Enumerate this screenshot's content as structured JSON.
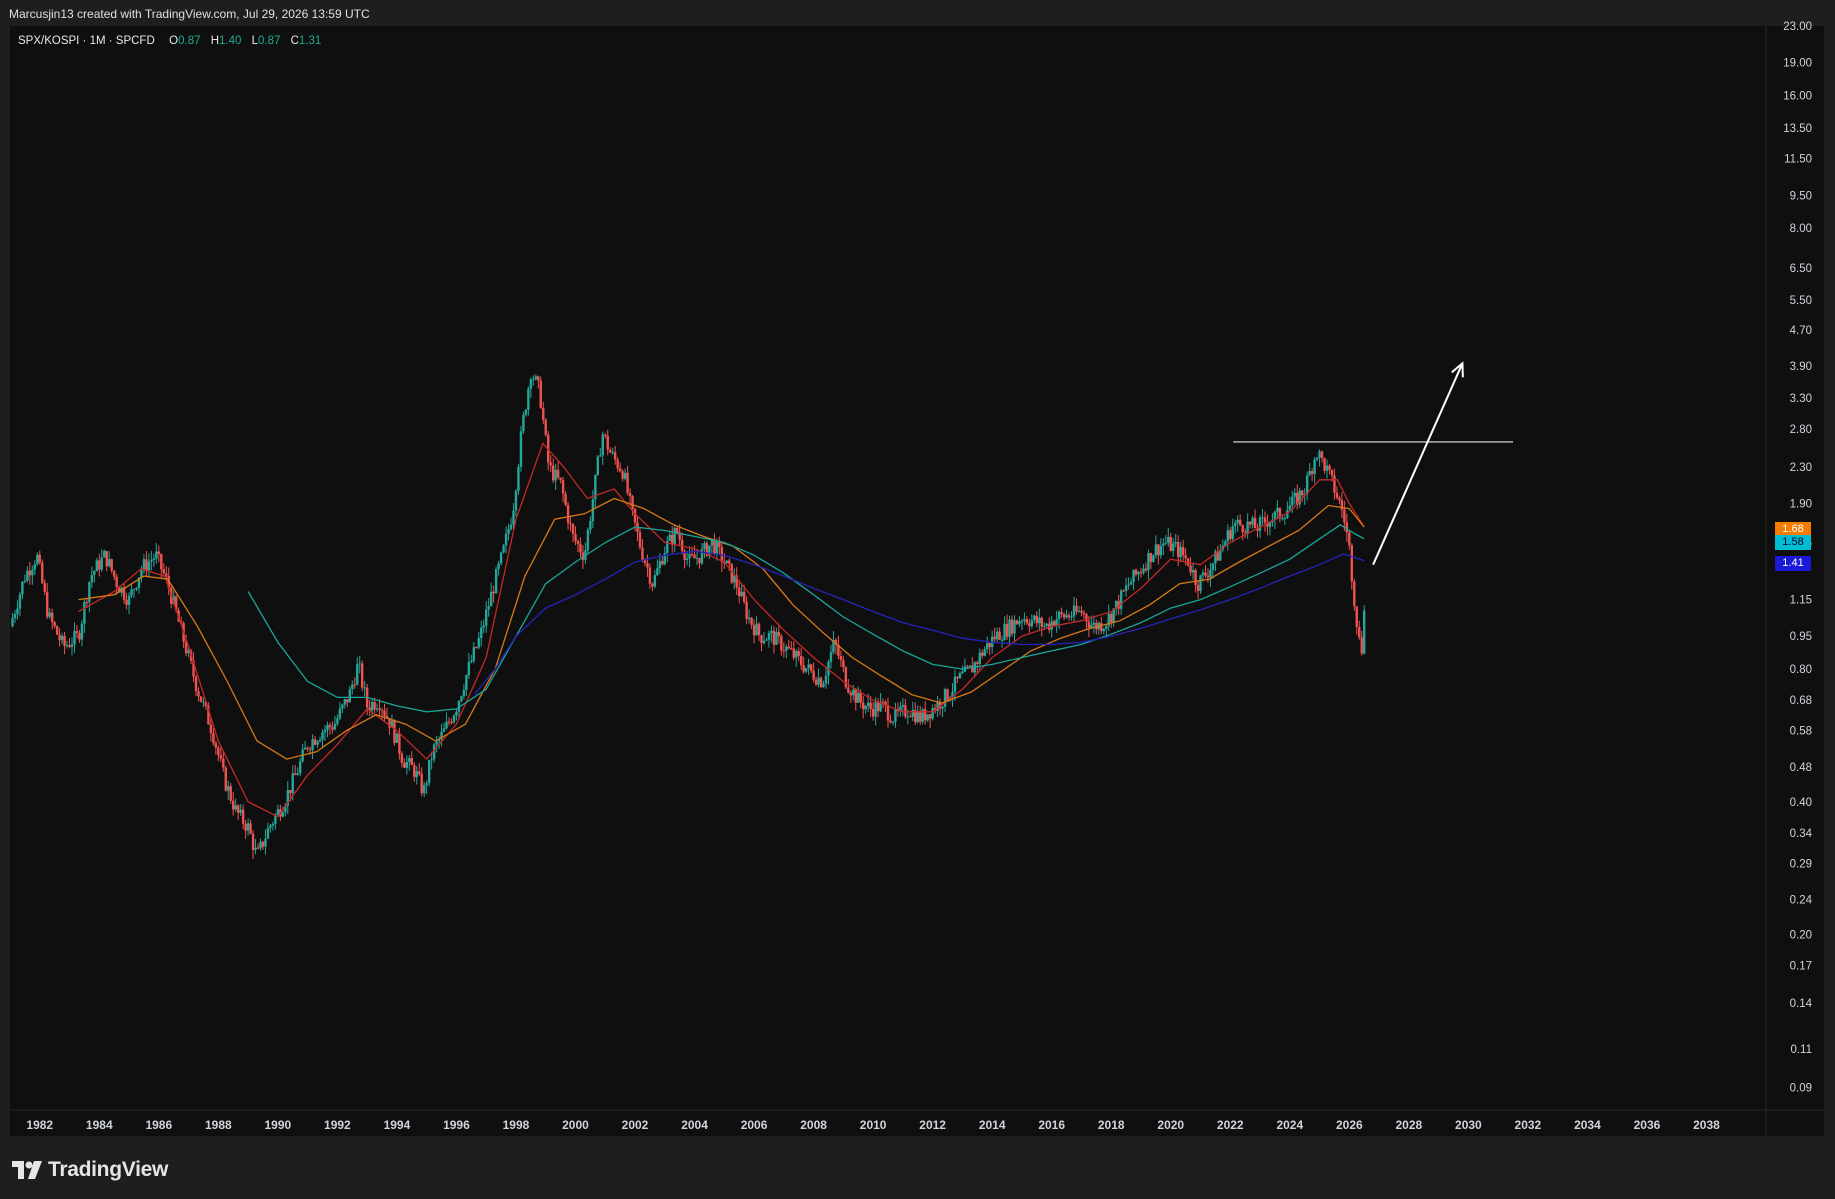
{
  "header": {
    "attribution": "Marcusjin13 created with TradingView.com, Jul 29, 2026 13:59 UTC"
  },
  "legend": {
    "symbol": "SPX/KOSPI · 1M · SPCFD",
    "o_label": "O",
    "o_value": "0.87",
    "h_label": "H",
    "h_value": "1.40",
    "l_label": "L",
    "l_value": "0.87",
    "c_label": "C",
    "c_value": "1.31"
  },
  "footer": {
    "logo": "TradingView"
  },
  "price_tags": [
    {
      "value": "1.68",
      "color": "#f57c00"
    },
    {
      "value": "1.58",
      "color": "#00bcd4"
    },
    {
      "value": "1.41",
      "color": "#1a1ad6"
    }
  ],
  "colors": {
    "background": "#0f0f0f",
    "up": "#26a69a",
    "down": "#ef5350",
    "ma_red": "#c62828",
    "ma_orange": "#d87a16",
    "ma_teal": "#1aa59a",
    "ma_blue": "#2424b8"
  },
  "chart_data": {
    "type": "candlestick",
    "title": "SPX/KOSPI · 1M · SPCFD",
    "scale": "log",
    "ylim": [
      0.08,
      23.0
    ],
    "xlim": [
      1981.0,
      2040.0
    ],
    "y_ticks": [
      "23.00",
      "19.00",
      "16.00",
      "13.50",
      "11.50",
      "9.50",
      "8.00",
      "6.50",
      "5.50",
      "4.70",
      "3.90",
      "3.30",
      "2.80",
      "2.30",
      "1.90",
      "1.55",
      "1.15",
      "0.95",
      "0.80",
      "0.68",
      "0.58",
      "0.48",
      "0.40",
      "0.34",
      "0.29",
      "0.24",
      "0.20",
      "0.17",
      "0.14",
      "0.11",
      "0.09"
    ],
    "x_ticks": [
      "1982",
      "1984",
      "1986",
      "1988",
      "1990",
      "1992",
      "1994",
      "1996",
      "1998",
      "2000",
      "2002",
      "2004",
      "2006",
      "2008",
      "2010",
      "2012",
      "2014",
      "2016",
      "2018",
      "2020",
      "2022",
      "2024",
      "2026",
      "2028",
      "2030",
      "2032",
      "2034",
      "2036",
      "2038"
    ],
    "close_path": [
      [
        1981.0,
        1.0
      ],
      [
        1981.5,
        1.3
      ],
      [
        1981.9,
        1.45
      ],
      [
        1982.3,
        1.05
      ],
      [
        1982.8,
        0.9
      ],
      [
        1983.3,
        0.95
      ],
      [
        1983.7,
        1.3
      ],
      [
        1984.2,
        1.45
      ],
      [
        1984.6,
        1.25
      ],
      [
        1985.0,
        1.15
      ],
      [
        1985.4,
        1.35
      ],
      [
        1985.9,
        1.45
      ],
      [
        1986.3,
        1.25
      ],
      [
        1986.8,
        0.95
      ],
      [
        1987.3,
        0.72
      ],
      [
        1987.8,
        0.58
      ],
      [
        1988.2,
        0.45
      ],
      [
        1988.6,
        0.38
      ],
      [
        1989.0,
        0.35
      ],
      [
        1989.3,
        0.3
      ],
      [
        1989.7,
        0.35
      ],
      [
        1990.2,
        0.4
      ],
      [
        1990.6,
        0.46
      ],
      [
        1991.0,
        0.54
      ],
      [
        1991.5,
        0.58
      ],
      [
        1991.9,
        0.6
      ],
      [
        1992.4,
        0.7
      ],
      [
        1992.7,
        0.82
      ],
      [
        1993.0,
        0.66
      ],
      [
        1993.4,
        0.68
      ],
      [
        1993.8,
        0.6
      ],
      [
        1994.2,
        0.5
      ],
      [
        1994.6,
        0.47
      ],
      [
        1994.9,
        0.42
      ],
      [
        1995.2,
        0.52
      ],
      [
        1995.6,
        0.58
      ],
      [
        1996.0,
        0.66
      ],
      [
        1996.4,
        0.8
      ],
      [
        1996.8,
        0.95
      ],
      [
        1997.2,
        1.2
      ],
      [
        1997.6,
        1.5
      ],
      [
        1997.9,
        1.85
      ],
      [
        1998.2,
        2.8
      ],
      [
        1998.5,
        3.8
      ],
      [
        1998.8,
        3.4
      ],
      [
        1999.1,
        2.3
      ],
      [
        1999.5,
        2.1
      ],
      [
        1999.9,
        1.6
      ],
      [
        2000.3,
        1.45
      ],
      [
        2000.7,
        2.2
      ],
      [
        2000.9,
        2.75
      ],
      [
        2001.2,
        2.45
      ],
      [
        2001.6,
        2.25
      ],
      [
        2001.9,
        1.8
      ],
      [
        2002.2,
        1.5
      ],
      [
        2002.6,
        1.25
      ],
      [
        2003.0,
        1.5
      ],
      [
        2003.4,
        1.65
      ],
      [
        2003.8,
        1.4
      ],
      [
        2004.2,
        1.45
      ],
      [
        2004.6,
        1.55
      ],
      [
        2005.0,
        1.4
      ],
      [
        2005.4,
        1.25
      ],
      [
        2005.8,
        1.05
      ],
      [
        2006.2,
        0.95
      ],
      [
        2006.6,
        0.95
      ],
      [
        2007.0,
        0.9
      ],
      [
        2007.4,
        0.85
      ],
      [
        2007.8,
        0.8
      ],
      [
        2008.3,
        0.75
      ],
      [
        2008.7,
        0.92
      ],
      [
        2009.1,
        0.75
      ],
      [
        2009.5,
        0.68
      ],
      [
        2009.9,
        0.65
      ],
      [
        2010.3,
        0.66
      ],
      [
        2010.7,
        0.62
      ],
      [
        2011.2,
        0.65
      ],
      [
        2011.6,
        0.62
      ],
      [
        2012.1,
        0.66
      ],
      [
        2012.5,
        0.7
      ],
      [
        2012.9,
        0.76
      ],
      [
        2013.3,
        0.8
      ],
      [
        2013.7,
        0.88
      ],
      [
        2014.1,
        0.95
      ],
      [
        2014.6,
        1.0
      ],
      [
        2015.0,
        1.05
      ],
      [
        2015.4,
        1.03
      ],
      [
        2015.8,
        1.0
      ],
      [
        2016.2,
        1.05
      ],
      [
        2016.6,
        1.06
      ],
      [
        2017.0,
        1.08
      ],
      [
        2017.4,
        1.0
      ],
      [
        2017.8,
        1.02
      ],
      [
        2018.2,
        1.12
      ],
      [
        2018.6,
        1.25
      ],
      [
        2019.0,
        1.35
      ],
      [
        2019.4,
        1.48
      ],
      [
        2019.8,
        1.55
      ],
      [
        2020.2,
        1.5
      ],
      [
        2020.6,
        1.4
      ],
      [
        2020.9,
        1.25
      ],
      [
        2021.3,
        1.35
      ],
      [
        2021.7,
        1.5
      ],
      [
        2022.1,
        1.7
      ],
      [
        2022.5,
        1.7
      ],
      [
        2022.9,
        1.68
      ],
      [
        2023.3,
        1.75
      ],
      [
        2023.7,
        1.8
      ],
      [
        2024.1,
        1.9
      ],
      [
        2024.5,
        2.05
      ],
      [
        2024.9,
        2.5
      ],
      [
        2025.2,
        2.3
      ],
      [
        2025.5,
        2.05
      ],
      [
        2025.8,
        1.8
      ],
      [
        2026.0,
        1.5
      ],
      [
        2026.2,
        1.1
      ],
      [
        2026.4,
        0.85
      ],
      [
        2026.55,
        1.31
      ]
    ],
    "moving_averages": [
      {
        "color_key": "ma_red",
        "value": "1.68",
        "points": [
          [
            1983.3,
            1.08
          ],
          [
            1984.5,
            1.2
          ],
          [
            1985.4,
            1.35
          ],
          [
            1986.2,
            1.3
          ],
          [
            1987.0,
            0.9
          ],
          [
            1988.0,
            0.55
          ],
          [
            1989.0,
            0.4
          ],
          [
            1990.0,
            0.37
          ],
          [
            1991.0,
            0.46
          ],
          [
            1992.0,
            0.54
          ],
          [
            1993.0,
            0.65
          ],
          [
            1994.0,
            0.58
          ],
          [
            1995.0,
            0.5
          ],
          [
            1996.0,
            0.6
          ],
          [
            1997.0,
            0.85
          ],
          [
            1998.0,
            1.75
          ],
          [
            1998.9,
            2.6
          ],
          [
            1999.6,
            2.3
          ],
          [
            2000.4,
            1.95
          ],
          [
            2001.3,
            2.05
          ],
          [
            2002.0,
            1.8
          ],
          [
            2003.0,
            1.55
          ],
          [
            2004.0,
            1.5
          ],
          [
            2005.0,
            1.4
          ],
          [
            2006.0,
            1.15
          ],
          [
            2007.0,
            0.98
          ],
          [
            2008.0,
            0.85
          ],
          [
            2009.0,
            0.75
          ],
          [
            2010.0,
            0.68
          ],
          [
            2011.0,
            0.64
          ],
          [
            2012.0,
            0.64
          ],
          [
            2013.0,
            0.72
          ],
          [
            2014.0,
            0.85
          ],
          [
            2015.0,
            0.95
          ],
          [
            2016.0,
            1.0
          ],
          [
            2017.0,
            1.03
          ],
          [
            2018.0,
            1.08
          ],
          [
            2019.0,
            1.22
          ],
          [
            2020.0,
            1.42
          ],
          [
            2021.0,
            1.38
          ],
          [
            2022.0,
            1.55
          ],
          [
            2023.0,
            1.68
          ],
          [
            2024.0,
            1.82
          ],
          [
            2025.0,
            2.15
          ],
          [
            2025.6,
            2.15
          ],
          [
            2026.0,
            1.9
          ],
          [
            2026.5,
            1.68
          ]
        ]
      },
      {
        "color_key": "ma_orange",
        "value": "1.68",
        "points": [
          [
            1983.3,
            1.15
          ],
          [
            1984.5,
            1.18
          ],
          [
            1985.5,
            1.3
          ],
          [
            1986.3,
            1.28
          ],
          [
            1987.3,
            1.0
          ],
          [
            1988.3,
            0.75
          ],
          [
            1989.3,
            0.55
          ],
          [
            1990.3,
            0.5
          ],
          [
            1991.3,
            0.52
          ],
          [
            1992.3,
            0.58
          ],
          [
            1993.3,
            0.63
          ],
          [
            1994.3,
            0.6
          ],
          [
            1995.3,
            0.55
          ],
          [
            1996.3,
            0.6
          ],
          [
            1997.3,
            0.8
          ],
          [
            1998.3,
            1.3
          ],
          [
            1999.3,
            1.75
          ],
          [
            2000.3,
            1.8
          ],
          [
            2001.3,
            1.95
          ],
          [
            2002.3,
            1.85
          ],
          [
            2003.3,
            1.7
          ],
          [
            2004.3,
            1.6
          ],
          [
            2005.3,
            1.52
          ],
          [
            2006.3,
            1.35
          ],
          [
            2007.3,
            1.12
          ],
          [
            2008.3,
            0.97
          ],
          [
            2009.3,
            0.85
          ],
          [
            2010.3,
            0.77
          ],
          [
            2011.3,
            0.7
          ],
          [
            2012.3,
            0.67
          ],
          [
            2013.3,
            0.71
          ],
          [
            2014.3,
            0.79
          ],
          [
            2015.3,
            0.88
          ],
          [
            2016.3,
            0.94
          ],
          [
            2017.3,
            0.99
          ],
          [
            2018.3,
            1.03
          ],
          [
            2019.3,
            1.12
          ],
          [
            2020.3,
            1.25
          ],
          [
            2021.3,
            1.28
          ],
          [
            2022.3,
            1.4
          ],
          [
            2023.3,
            1.52
          ],
          [
            2024.3,
            1.65
          ],
          [
            2025.3,
            1.88
          ],
          [
            2026.0,
            1.85
          ],
          [
            2026.5,
            1.68
          ]
        ]
      },
      {
        "color_key": "ma_teal",
        "value": "1.58",
        "points": [
          [
            1989.0,
            1.2
          ],
          [
            1990.0,
            0.92
          ],
          [
            1991.0,
            0.75
          ],
          [
            1992.0,
            0.69
          ],
          [
            1993.0,
            0.69
          ],
          [
            1994.0,
            0.66
          ],
          [
            1995.0,
            0.64
          ],
          [
            1996.0,
            0.65
          ],
          [
            1997.0,
            0.72
          ],
          [
            1998.0,
            0.95
          ],
          [
            1999.0,
            1.25
          ],
          [
            2000.0,
            1.4
          ],
          [
            2001.0,
            1.55
          ],
          [
            2002.0,
            1.68
          ],
          [
            2003.0,
            1.65
          ],
          [
            2004.0,
            1.6
          ],
          [
            2005.0,
            1.55
          ],
          [
            2006.0,
            1.45
          ],
          [
            2007.0,
            1.32
          ],
          [
            2008.0,
            1.18
          ],
          [
            2009.0,
            1.05
          ],
          [
            2010.0,
            0.96
          ],
          [
            2011.0,
            0.88
          ],
          [
            2012.0,
            0.82
          ],
          [
            2013.0,
            0.8
          ],
          [
            2014.0,
            0.82
          ],
          [
            2015.0,
            0.85
          ],
          [
            2016.0,
            0.88
          ],
          [
            2017.0,
            0.91
          ],
          [
            2018.0,
            0.96
          ],
          [
            2019.0,
            1.02
          ],
          [
            2020.0,
            1.1
          ],
          [
            2021.0,
            1.15
          ],
          [
            2022.0,
            1.23
          ],
          [
            2023.0,
            1.32
          ],
          [
            2024.0,
            1.42
          ],
          [
            2025.0,
            1.58
          ],
          [
            2025.7,
            1.7
          ],
          [
            2026.2,
            1.62
          ],
          [
            2026.5,
            1.58
          ]
        ]
      },
      {
        "color_key": "ma_blue",
        "value": "1.41",
        "points": [
          [
            1996.6,
            0.7
          ],
          [
            1997.3,
            0.8
          ],
          [
            1998.0,
            0.95
          ],
          [
            1999.0,
            1.1
          ],
          [
            2000.0,
            1.18
          ],
          [
            2001.0,
            1.28
          ],
          [
            2002.0,
            1.4
          ],
          [
            2003.0,
            1.45
          ],
          [
            2004.0,
            1.48
          ],
          [
            2005.0,
            1.45
          ],
          [
            2006.0,
            1.38
          ],
          [
            2007.0,
            1.3
          ],
          [
            2008.0,
            1.22
          ],
          [
            2009.0,
            1.15
          ],
          [
            2010.0,
            1.08
          ],
          [
            2011.0,
            1.02
          ],
          [
            2012.0,
            0.98
          ],
          [
            2013.0,
            0.94
          ],
          [
            2014.0,
            0.92
          ],
          [
            2015.0,
            0.91
          ],
          [
            2016.0,
            0.91
          ],
          [
            2017.0,
            0.92
          ],
          [
            2018.0,
            0.95
          ],
          [
            2019.0,
            0.99
          ],
          [
            2020.0,
            1.04
          ],
          [
            2021.0,
            1.09
          ],
          [
            2022.0,
            1.15
          ],
          [
            2023.0,
            1.22
          ],
          [
            2024.0,
            1.3
          ],
          [
            2025.0,
            1.38
          ],
          [
            2025.8,
            1.46
          ],
          [
            2026.5,
            1.41
          ]
        ]
      }
    ],
    "annotations": [
      {
        "type": "horizontal_line",
        "price": 2.62,
        "from": 2022.1,
        "to": 2031.5
      },
      {
        "type": "arrow",
        "from": [
          2026.8,
          1.38
        ],
        "to": [
          2029.8,
          3.95
        ]
      }
    ]
  }
}
